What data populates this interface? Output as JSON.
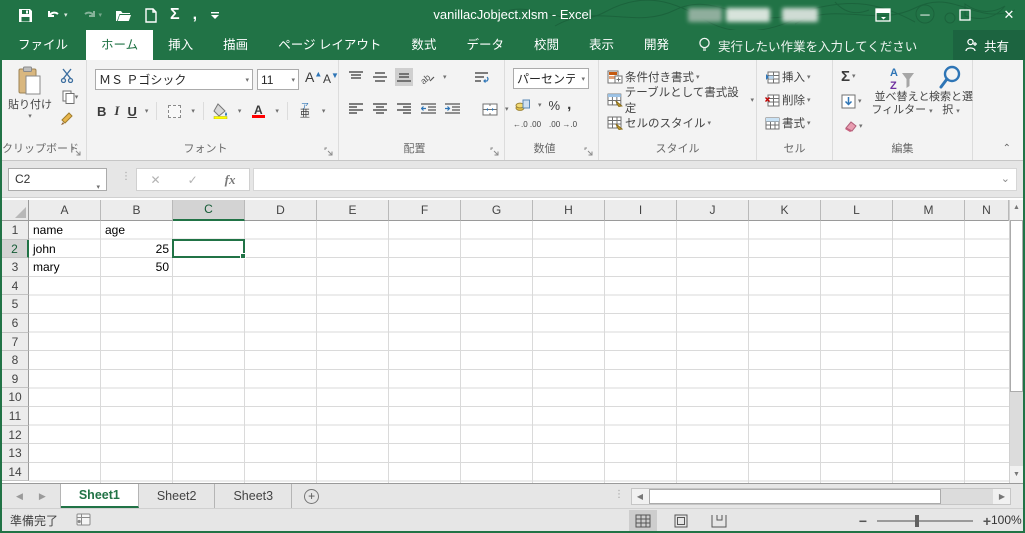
{
  "titlebar": {
    "title": "vanillacJobject.xlsm - Excel",
    "qat_icons": [
      "save-icon",
      "undo-icon",
      "redo-icon",
      "open-icon",
      "new-icon",
      "autosum-icon",
      "comma-icon",
      "customize-qat-icon"
    ],
    "sigma": "Σ",
    "comma": ","
  },
  "tabs": [
    {
      "label": "ファイル",
      "active": false
    },
    {
      "label": "ホーム",
      "active": true
    },
    {
      "label": "挿入",
      "active": false
    },
    {
      "label": "描画",
      "active": false
    },
    {
      "label": "ページ レイアウト",
      "active": false
    },
    {
      "label": "数式",
      "active": false
    },
    {
      "label": "データ",
      "active": false
    },
    {
      "label": "校閲",
      "active": false
    },
    {
      "label": "表示",
      "active": false
    },
    {
      "label": "開発",
      "active": false
    }
  ],
  "tellme": {
    "text": "実行したい作業を入力してください"
  },
  "share": {
    "label": "共有"
  },
  "ribbon": {
    "clipboard": {
      "label": "クリップボード",
      "paste": "貼り付け"
    },
    "font": {
      "label": "フォント",
      "font_name": "ＭＳ Ｐゴシック",
      "font_size": "11",
      "bold": "B",
      "italic": "I",
      "underline": "U",
      "font_color_letter": "A",
      "phonetic_top": "ア",
      "phonetic_bottom": "亜"
    },
    "alignment": {
      "label": "配置"
    },
    "number": {
      "label": "数値",
      "format": "パーセンテージ",
      "percent": "%",
      "comma": ",",
      "inc_dec": "←.0 .00",
      "dec_dec": ".00 →.0"
    },
    "styles": {
      "label": "スタイル",
      "items": [
        "条件付き書式",
        "テーブルとして書式設定",
        "セルのスタイル"
      ]
    },
    "cells": {
      "label": "セル",
      "items": [
        "挿入",
        "削除",
        "書式"
      ]
    },
    "editing": {
      "label": "編集",
      "sigma": "Σ",
      "sort_filter": "並べ替えとフィルター",
      "find_select": "検索と選択"
    }
  },
  "formula_bar": {
    "name_box": "C2",
    "fx": "fx",
    "formula_value": ""
  },
  "grid": {
    "columns": [
      "A",
      "B",
      "C",
      "D",
      "E",
      "F",
      "G",
      "H",
      "I",
      "J",
      "K",
      "L",
      "M",
      "N"
    ],
    "visible_rows": 14,
    "selected_column": "C",
    "selected_row": 2,
    "selection_ref": "C2",
    "selection": {
      "col": 2,
      "row": 1
    },
    "cells": [
      {
        "row": 0,
        "col": 0,
        "value": "name",
        "align": "left"
      },
      {
        "row": 0,
        "col": 1,
        "value": "age",
        "align": "left"
      },
      {
        "row": 1,
        "col": 0,
        "value": "john",
        "align": "left"
      },
      {
        "row": 1,
        "col": 1,
        "value": "25",
        "align": "right"
      },
      {
        "row": 2,
        "col": 0,
        "value": "mary",
        "align": "left"
      },
      {
        "row": 2,
        "col": 1,
        "value": "50",
        "align": "right"
      }
    ]
  },
  "sheet_tabs": {
    "tabs": [
      {
        "name": "Sheet1",
        "active": true
      },
      {
        "name": "Sheet2",
        "active": false
      },
      {
        "name": "Sheet3",
        "active": false
      }
    ]
  },
  "status_bar": {
    "mode": "準備完了",
    "zoom_level": "100%"
  },
  "colors": {
    "excel_green": "#217346",
    "selection_border": "#217346",
    "fill_yellow": "#ffff00",
    "font_red": "#ff0000"
  }
}
